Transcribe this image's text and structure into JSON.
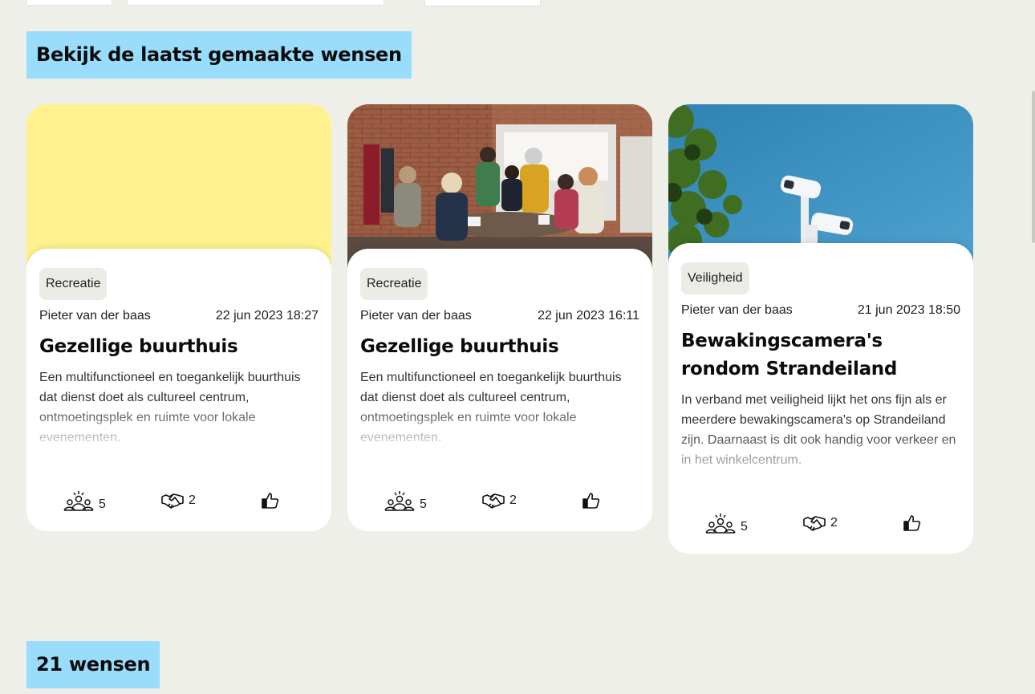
{
  "sections": {
    "latest_heading": "Bekijk de laatst gemaakte wensen",
    "count_heading": "21 wensen"
  },
  "cards": [
    {
      "category": "Recreatie",
      "author": "Pieter van der baas",
      "date": "22 jun 2023 18:27",
      "title": "Gezellige buurthuis",
      "description": "Een multifunctioneel en toegankelijk buurthuis dat dienst doet als cultureel centrum, ontmoetingsplek en ruimte voor lokale evenementen.",
      "supporters": "5",
      "partners": "2",
      "media": "plain-yellow-placeholder"
    },
    {
      "category": "Recreatie",
      "author": "Pieter van der baas",
      "date": "22 jun 2023 16:11",
      "title": "Gezellige buurthuis",
      "description": "Een multifunctioneel en toegankelijk buurthuis dat dienst doet als cultureel centrum, ontmoetingsplek en ruimte voor lokale evenementen.",
      "supporters": "5",
      "partners": "2",
      "media": "photo-people-at-table"
    },
    {
      "category": "Veiligheid",
      "author": "Pieter van der baas",
      "date": "21 jun 2023 18:50",
      "title": "Bewakingscamera's rondom Strandeiland",
      "description": "In verband met veiligheid lijkt het ons fijn als er meerdere bewakingscamera's op Strandeiland zijn. Daarnaast is dit ook handig voor verkeer en in het winkelcentrum.",
      "supporters": "5",
      "partners": "2",
      "media": "photo-security-cameras"
    }
  ],
  "icons": {
    "supporters": "people-group-icon",
    "partners": "handshake-icon",
    "like": "thumbs-up-icon"
  },
  "colors": {
    "background": "#efefea",
    "heading_highlight": "#99dcfb",
    "placeholder_yellow": "#fff28e",
    "card": "#ffffff",
    "tag": "#ececE7"
  }
}
